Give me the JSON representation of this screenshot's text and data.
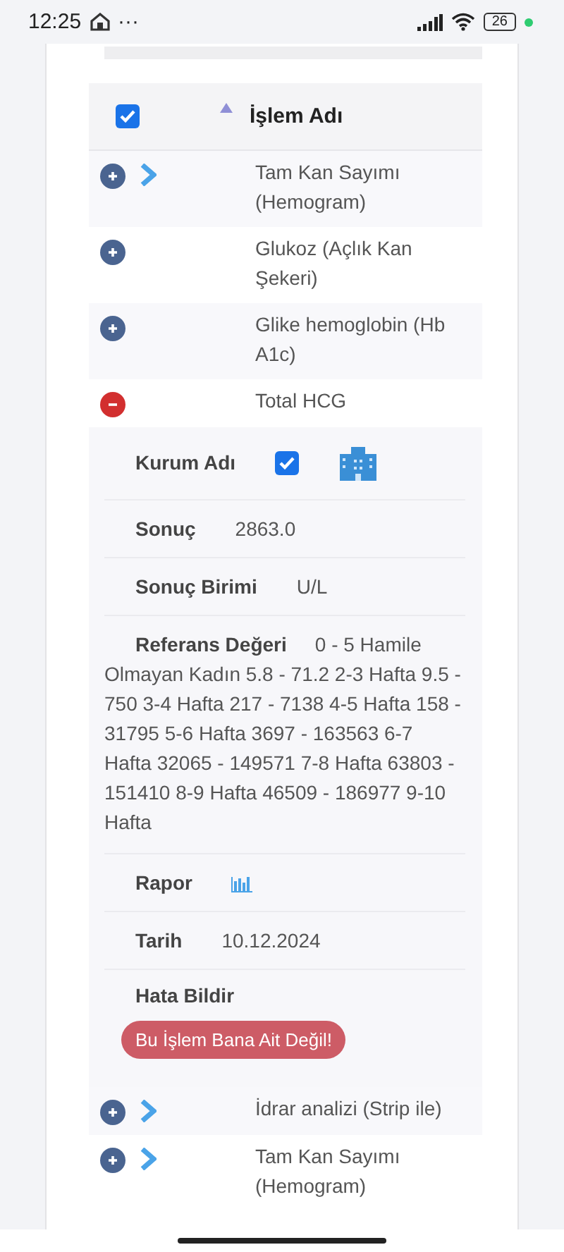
{
  "status_bar": {
    "time": "12:25",
    "dots": "···",
    "battery": "26"
  },
  "table": {
    "header": {
      "checked": true,
      "title": "İşlem Adı"
    },
    "rows": [
      {
        "name": "Tam Kan Sayımı (Hemogram)",
        "expanded": false,
        "arrow": true
      },
      {
        "name": "Glukoz (Açlık Kan Şekeri)",
        "expanded": false,
        "arrow": false
      },
      {
        "name": "Glike hemoglobin (Hb A1c)",
        "expanded": false,
        "arrow": false
      },
      {
        "name": "Total HCG",
        "expanded": true,
        "arrow": false,
        "details": [
          {
            "kind": "institution",
            "label": "Kurum Adı",
            "checked": true
          },
          {
            "kind": "text",
            "label": "Sonuç",
            "value": "2863.0"
          },
          {
            "kind": "text",
            "label": "Sonuç Birimi",
            "value": "U/L"
          },
          {
            "kind": "wrap",
            "label": "Referans Değeri",
            "value": "0 - 5 Hamile Olmayan Kadın 5.8 - 71.2 2-3 Hafta 9.5 - 750 3-4 Hafta 217 - 7138 4-5 Hafta 158 - 31795 5-6 Hafta 3697 - 163563 6-7 Hafta 32065 - 149571 7-8 Hafta 63803 - 151410 8-9 Hafta 46509 - 186977 9-10 Hafta"
          },
          {
            "kind": "report",
            "label": "Rapor"
          },
          {
            "kind": "text",
            "label": "Tarih",
            "value": "10.12.2024"
          },
          {
            "kind": "action",
            "label": "Hata Bildir",
            "button": "Bu İşlem Bana Ait Değil!"
          }
        ]
      },
      {
        "name": "İdrar analizi (Strip ile)",
        "expanded": false,
        "arrow": true
      },
      {
        "name": "Tam Kan Sayımı (Hemogram)",
        "expanded": false,
        "arrow": true
      }
    ]
  }
}
